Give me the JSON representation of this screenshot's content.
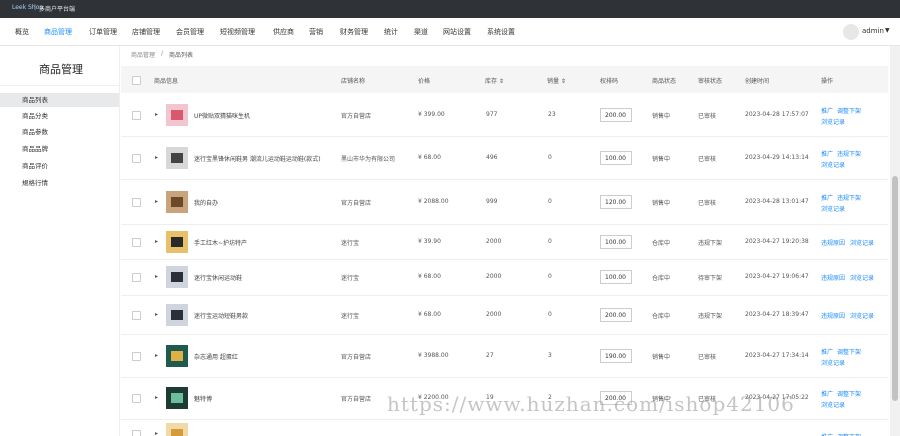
{
  "topbar": {
    "brand": "Leek Shop",
    "separator": "|",
    "subtitle": "多商户平台端"
  },
  "nav": {
    "items": [
      {
        "label": "概览"
      },
      {
        "label": "商品管理"
      },
      {
        "label": "订单管理"
      },
      {
        "label": "店铺管理"
      },
      {
        "label": "会员管理"
      },
      {
        "label": "短视频管理"
      },
      {
        "label": "供应商"
      },
      {
        "label": "营销"
      },
      {
        "label": "财务管理"
      },
      {
        "label": "统计"
      },
      {
        "label": "渠道"
      },
      {
        "label": "网站设置"
      },
      {
        "label": "系统设置"
      }
    ],
    "active": "商品管理",
    "user": "admin",
    "caret": "▼"
  },
  "sidebar": {
    "title": "商品管理",
    "items": [
      {
        "label": "商品列表"
      },
      {
        "label": "商品分类"
      },
      {
        "label": "商品参数"
      },
      {
        "label": "商品品牌"
      },
      {
        "label": "商品评价"
      },
      {
        "label": "規格行情"
      }
    ]
  },
  "breadcrumb": {
    "first": "商品管理",
    "sep": "/",
    "current": "商品列表"
  },
  "table": {
    "headers": {
      "info": "商品信息",
      "shop": "店铺名称",
      "price": "价格",
      "stock": "库存 ⇕",
      "sales": "销量 ⇕",
      "rank": "权排码",
      "status": "商品状态",
      "review": "审核状态",
      "created": "创建时间",
      "actions": "操作"
    },
    "rows": [
      {
        "name": "UP微贴双猜猫咪生机",
        "shop": "官方自营店",
        "price": "¥ 399.00",
        "stock": "977",
        "sales": "23",
        "rank": "200.00",
        "status": "销售中",
        "review": "已审核",
        "created": "2023-04-28 17:57:07",
        "actions": [
          "推广",
          "调整下架",
          "浏览记录"
        ]
      },
      {
        "name": "迷行宝黑锋休闲鞋男 潮流儿运动鞋运动鞋(款式)",
        "shop": "黑山市华为有限公司",
        "price": "¥ 68.00",
        "stock": "496",
        "sales": "0",
        "rank": "100.00",
        "status": "销售中",
        "review": "已审核",
        "created": "2023-04-29 14:13:14",
        "actions": [
          "推广",
          "违规下架",
          "浏览记录"
        ]
      },
      {
        "name": "我的自办",
        "shop": "官方自营店",
        "price": "¥ 2088.00",
        "stock": "999",
        "sales": "0",
        "rank": "120.00",
        "status": "销售中",
        "review": "已审核",
        "created": "2023-04-28 13:01:47",
        "actions": [
          "推广",
          "违规下架",
          "浏览记录"
        ]
      },
      {
        "name": "手工红木~护坊特产",
        "shop": "迷行宝",
        "price": "¥ 39.90",
        "stock": "2000",
        "sales": "0",
        "rank": "100.00",
        "status": "仓库中",
        "review": "违规下架",
        "created": "2023-04-27 19:20:38",
        "actions": [
          "违规原因",
          "浏览记录"
        ]
      },
      {
        "name": "迷行宝休闲运动鞋",
        "shop": "迷行宝",
        "price": "¥ 68.00",
        "stock": "2000",
        "sales": "0",
        "rank": "100.00",
        "status": "仓库中",
        "review": "待审下架",
        "created": "2023-04-27 19:06:47",
        "actions": [
          "违规原因",
          "浏览记录"
        ]
      },
      {
        "name": "迷行宝运动短鞋男款",
        "shop": "迷行宝",
        "price": "¥ 68.00",
        "stock": "2000",
        "sales": "0",
        "rank": "200.00",
        "status": "仓库中",
        "review": "违规下架",
        "created": "2023-04-27 18:39:47",
        "actions": [
          "违规原因",
          "浏览记录"
        ]
      },
      {
        "name": "杂志通用 超蛋红",
        "shop": "官方自营店",
        "price": "¥ 3988.00",
        "stock": "27",
        "sales": "3",
        "rank": "190.00",
        "status": "销售中",
        "review": "已审核",
        "created": "2023-04-27 17:34:14",
        "actions": [
          "推广",
          "调整下架",
          "浏览记录"
        ]
      },
      {
        "name": "魅特博",
        "shop": "官方自营店",
        "price": "¥ 2200.00",
        "stock": "19",
        "sales": "2",
        "rank": "200.00",
        "status": "销售中",
        "review": "已审核",
        "created": "2023-04-27 17:05:22",
        "actions": [
          "推广",
          "调整下架",
          "浏览记录"
        ]
      },
      {
        "name": "",
        "shop": "",
        "price": "",
        "stock": "",
        "sales": "",
        "rank": "",
        "status": "",
        "review": "",
        "created": "",
        "actions": [
          "推广",
          "调整下架"
        ]
      }
    ]
  },
  "watermark": "https://www.huzhan.com/ishop42106",
  "colors": {
    "topbar": "#2f3337",
    "accent": "#1a8cff",
    "header_bg": "#f5f5f5",
    "sidebar_active": "#e8e9eb"
  }
}
